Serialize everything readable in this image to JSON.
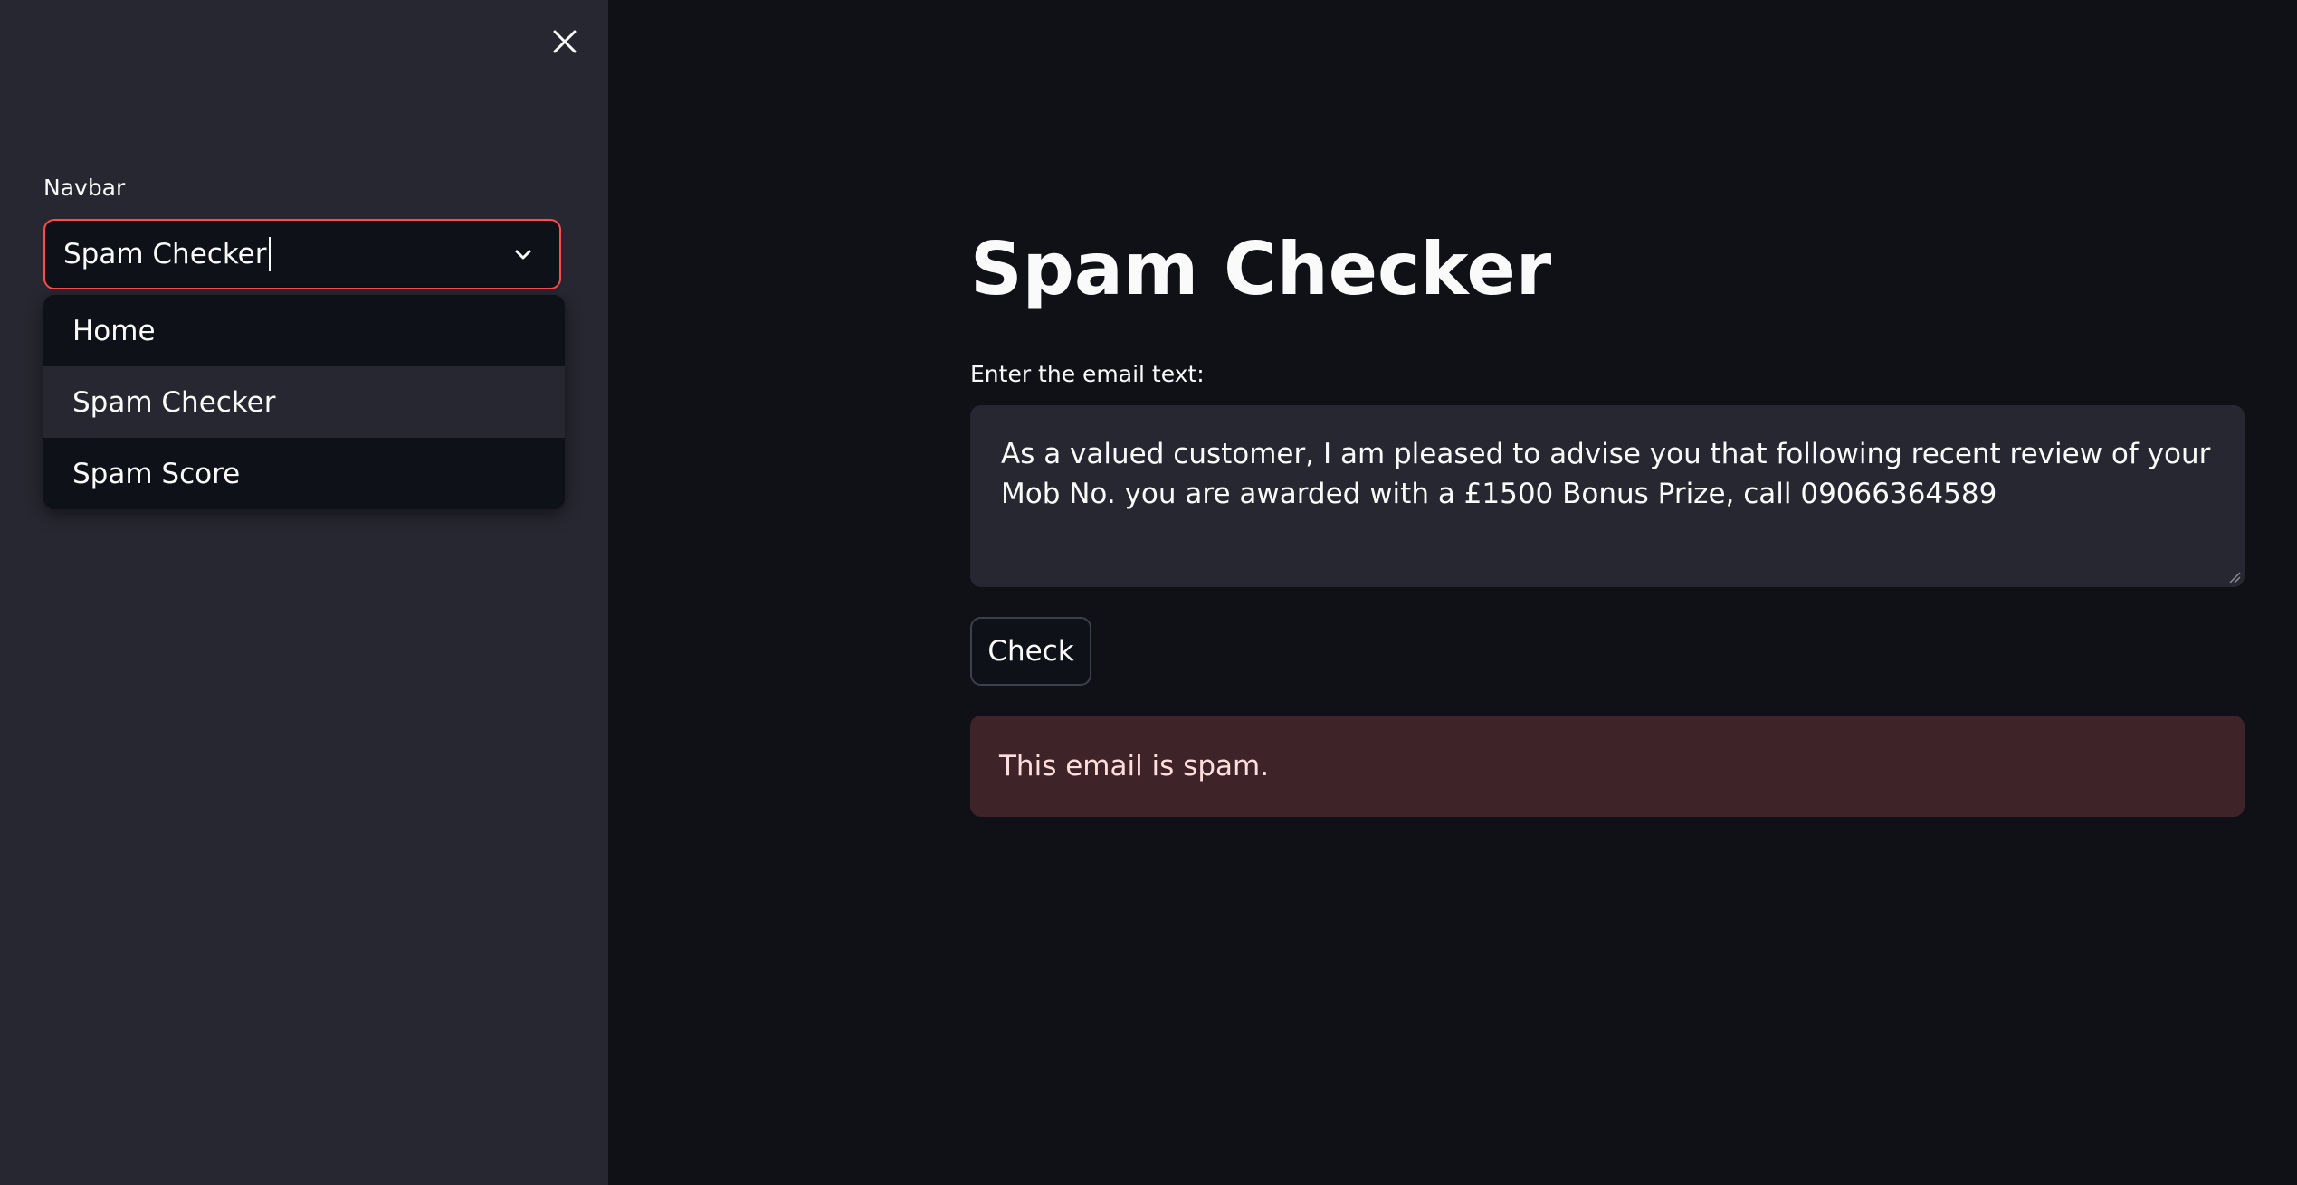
{
  "sidebar": {
    "close_icon": "close-icon",
    "navbar_label": "Navbar",
    "select": {
      "value": "Spam Checker",
      "chevron_icon": "chevron-down-icon",
      "border_color": "#ff4b4b"
    },
    "dropdown": {
      "options": [
        {
          "label": "Home"
        },
        {
          "label": "Spam Checker",
          "highlighted": true
        },
        {
          "label": "Spam Score"
        }
      ]
    }
  },
  "main": {
    "title": "Spam Checker",
    "textarea_label": "Enter the email text:",
    "textarea_value": "As a valued customer, I am pleased to advise you that following recent review of your Mob No. you are awarded with a £1500 Bonus Prize, call 09066364589",
    "check_button_label": "Check",
    "result_message": "This email is spam.",
    "result_color": "#3e2328"
  }
}
